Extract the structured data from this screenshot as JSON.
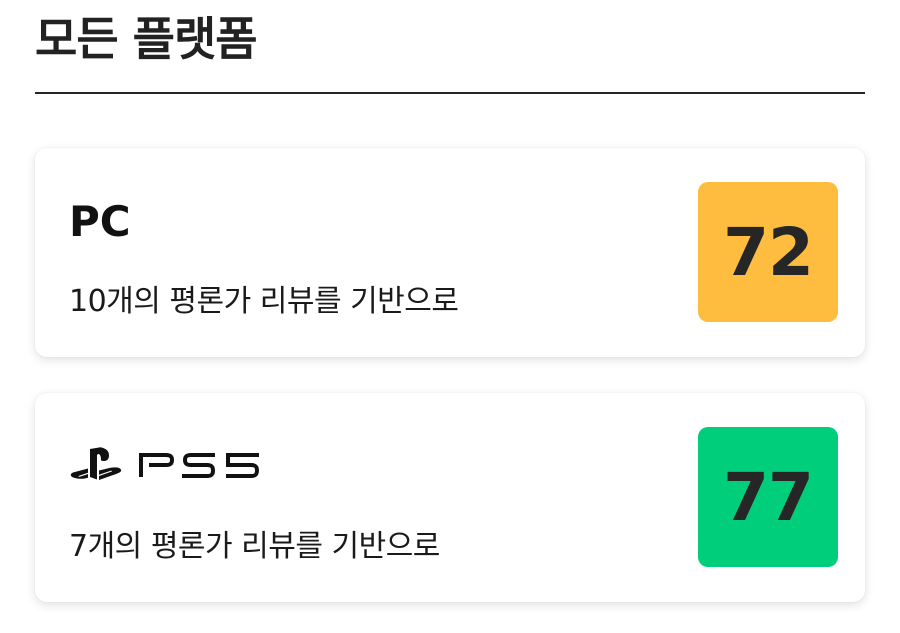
{
  "section": {
    "title": "모든 플랫폼"
  },
  "platforms": [
    {
      "name": "PC",
      "review_text": "10개의 평론가 리뷰를 기반으로",
      "score": "72",
      "score_color": "#FFBD3F"
    },
    {
      "name": "PS5",
      "logo_icon": "playstation-ps5-logo-icon",
      "review_text": "7개의 평론가 리뷰를 기반으로",
      "score": "77",
      "score_color": "#00CE7A"
    }
  ]
}
